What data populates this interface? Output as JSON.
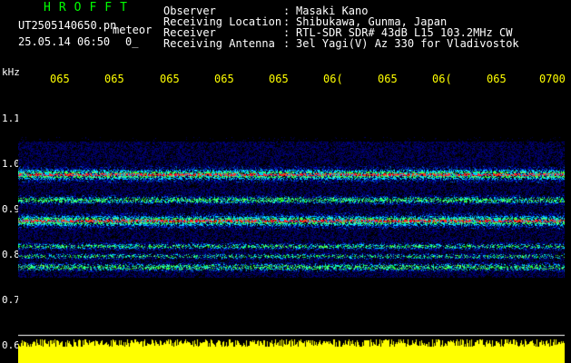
{
  "station": {
    "title": "HROFFT",
    "filename": "UT2505140650.pn",
    "mode": "meteor",
    "date_time": "25.05.14 06:50",
    "count": "0_"
  },
  "details": {
    "labels": [
      "Observer",
      "Receiving Location",
      "Receiver",
      "Receiving Antenna"
    ],
    "separators": [
      ":",
      ":",
      ":",
      ":"
    ],
    "values": [
      "Masaki Kano",
      "Shibukawa, Gunma, Japan",
      "RTL-SDR SDR# 43dB L15 103.2MHz CW",
      "3el Yagi(V) Az 330 for Vladivostok"
    ]
  },
  "axis": {
    "unit": "kHz",
    "y_ticks": [
      "1.1",
      "1.0",
      "0.9",
      "0.8",
      "0.7",
      "0.6"
    ],
    "x_ticks": [
      "065",
      "065",
      "065",
      "065",
      "065",
      "06(",
      "065",
      "06(",
      "065",
      "0700"
    ]
  },
  "colors": {
    "background": "#000000",
    "green_title": "#00ff00",
    "time_labels": "#ffff00",
    "noise_floor": "#ffff00"
  }
}
